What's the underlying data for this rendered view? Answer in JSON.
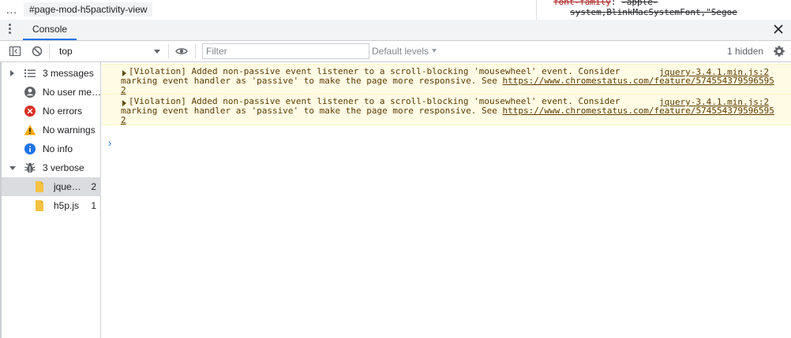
{
  "top_strip": {
    "more": "...",
    "breadcrumb": "#page-mod-h5pactivity-view",
    "css_prop_name": "font-family",
    "css_prop_value": "-apple-",
    "css_prop_cont": "system,BlinkMacSystemFont,\"Segoe"
  },
  "drawer": {
    "tab_label": "Console"
  },
  "toolbar": {
    "context": "top",
    "filter_placeholder": "Filter",
    "levels": "Default levels",
    "hidden": "1 hidden"
  },
  "sidebar": {
    "items": [
      {
        "label": "3 messages",
        "icon": "list-icon"
      },
      {
        "label": "No user me…",
        "icon": "user-icon"
      },
      {
        "label": "No errors",
        "icon": "error-icon"
      },
      {
        "label": "No warnings",
        "icon": "warning-icon"
      },
      {
        "label": "No info",
        "icon": "info-icon"
      },
      {
        "label": "3 verbose",
        "icon": "bug-icon"
      }
    ],
    "files": [
      {
        "label": "jque…",
        "count": "2"
      },
      {
        "label": "h5p.js",
        "count": "1"
      }
    ]
  },
  "messages": [
    {
      "line1": "[Violation] Added non-passive event listener to a scroll-blocking 'mousewheel' event. Consider",
      "line2_pre": "marking event handler as 'passive' to make the page more responsive. See ",
      "link": "https://www.chromestatus.com/feature/574554379596595",
      "line3": "2",
      "source": "jquery-3.4.1.min.js:2"
    },
    {
      "line1": "[Violation] Added non-passive event listener to a scroll-blocking 'mousewheel' event. Consider",
      "line2_pre": "marking event handler as 'passive' to make the page more responsive. See ",
      "link": "https://www.chromestatus.com/feature/574554379596595",
      "line3": "2",
      "source": "jquery-3.4.1.min.js:2"
    }
  ],
  "prompt": "›",
  "colors": {
    "accent": "#1a73e8",
    "warning_bg": "#fffbe5",
    "warning_text": "#5c3c00",
    "error": "#d93025",
    "warning_icon": "#f9ab00",
    "file_icon": "#f5c242"
  }
}
